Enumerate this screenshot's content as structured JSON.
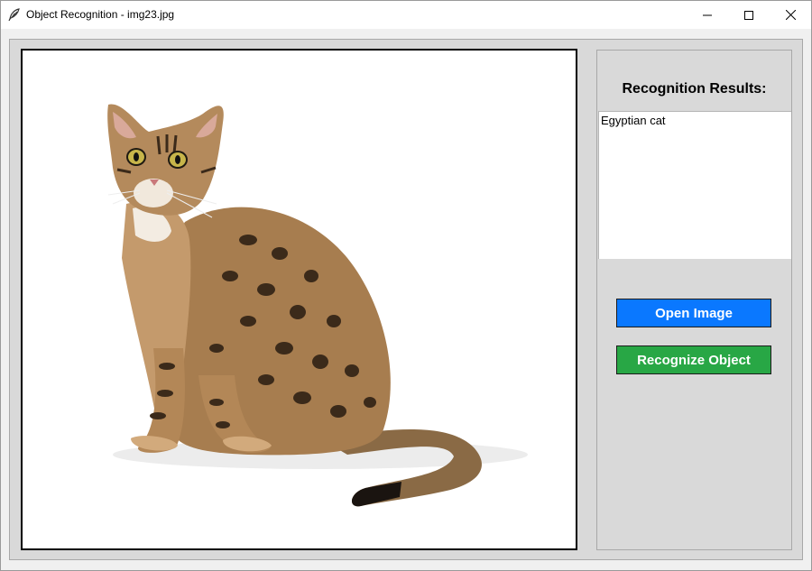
{
  "window": {
    "title": "Object Recognition - img23.jpg",
    "icon": "feather-tk-icon",
    "controls": [
      "minimize-icon",
      "maximize-icon",
      "close-icon"
    ]
  },
  "image": {
    "subject": "cat-photo"
  },
  "results": {
    "heading": "Recognition Results:",
    "text": "Egyptian cat"
  },
  "buttons": {
    "open_label": "Open Image",
    "recognize_label": "Recognize Object"
  },
  "colors": {
    "open_button": "#0a78ff",
    "recognize_button": "#28a745",
    "panel_bg": "#d9d9d9"
  }
}
